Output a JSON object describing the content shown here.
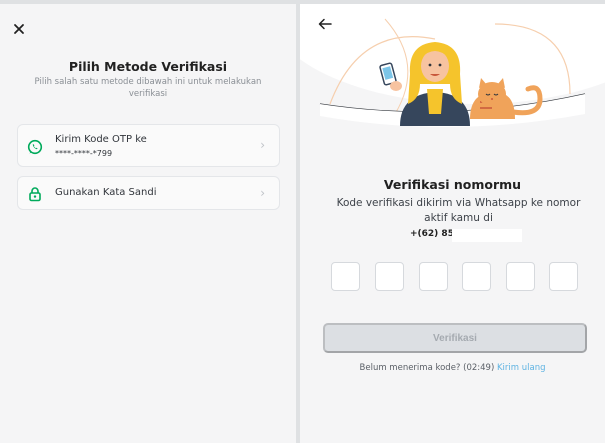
{
  "left": {
    "title": "Pilih Metode Verifikasi",
    "subtitle": "Pilih salah satu metode dibawah ini untuk melakukan verifikasi",
    "methods": [
      {
        "title": "Kirim Kode OTP ke",
        "subtitle": "****-****-*799",
        "icon": "whatsapp-icon"
      },
      {
        "title": "Gunakan Kata Sandi",
        "icon": "lock-icon"
      }
    ],
    "chevron": "›"
  },
  "right": {
    "title": "Verifikasi nomormu",
    "description": "Kode verifikasi dikirim via Whatsapp ke nomor aktif kamu di",
    "phone": "+(62) 85",
    "otp_values": [
      "",
      "",
      "",
      "",
      "",
      ""
    ],
    "verify_label": "Verifikasi",
    "resend_prefix": "Belum menerima kode? (02:49) ",
    "resend_link": "Kirim ulang"
  },
  "colors": {
    "accent_green": "#00aa5b",
    "link_blue": "#5fb3e2",
    "illustration_orange": "#f0a35a",
    "illustration_yellow": "#f5c42c"
  }
}
